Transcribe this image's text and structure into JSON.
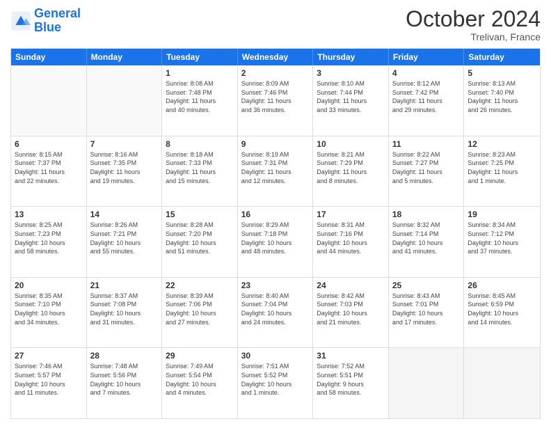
{
  "header": {
    "logo_line1": "General",
    "logo_line2": "Blue",
    "month": "October 2024",
    "location": "Trelivan, France"
  },
  "days_of_week": [
    "Sunday",
    "Monday",
    "Tuesday",
    "Wednesday",
    "Thursday",
    "Friday",
    "Saturday"
  ],
  "weeks": [
    [
      {
        "day": "",
        "lines": []
      },
      {
        "day": "",
        "lines": []
      },
      {
        "day": "1",
        "lines": [
          "Sunrise: 8:08 AM",
          "Sunset: 7:48 PM",
          "Daylight: 11 hours",
          "and 40 minutes."
        ]
      },
      {
        "day": "2",
        "lines": [
          "Sunrise: 8:09 AM",
          "Sunset: 7:46 PM",
          "Daylight: 11 hours",
          "and 36 minutes."
        ]
      },
      {
        "day": "3",
        "lines": [
          "Sunrise: 8:10 AM",
          "Sunset: 7:44 PM",
          "Daylight: 11 hours",
          "and 33 minutes."
        ]
      },
      {
        "day": "4",
        "lines": [
          "Sunrise: 8:12 AM",
          "Sunset: 7:42 PM",
          "Daylight: 11 hours",
          "and 29 minutes."
        ]
      },
      {
        "day": "5",
        "lines": [
          "Sunrise: 8:13 AM",
          "Sunset: 7:40 PM",
          "Daylight: 11 hours",
          "and 26 minutes."
        ]
      }
    ],
    [
      {
        "day": "6",
        "lines": [
          "Sunrise: 8:15 AM",
          "Sunset: 7:37 PM",
          "Daylight: 11 hours",
          "and 22 minutes."
        ]
      },
      {
        "day": "7",
        "lines": [
          "Sunrise: 8:16 AM",
          "Sunset: 7:35 PM",
          "Daylight: 11 hours",
          "and 19 minutes."
        ]
      },
      {
        "day": "8",
        "lines": [
          "Sunrise: 8:18 AM",
          "Sunset: 7:33 PM",
          "Daylight: 11 hours",
          "and 15 minutes."
        ]
      },
      {
        "day": "9",
        "lines": [
          "Sunrise: 8:19 AM",
          "Sunset: 7:31 PM",
          "Daylight: 11 hours",
          "and 12 minutes."
        ]
      },
      {
        "day": "10",
        "lines": [
          "Sunrise: 8:21 AM",
          "Sunset: 7:29 PM",
          "Daylight: 11 hours",
          "and 8 minutes."
        ]
      },
      {
        "day": "11",
        "lines": [
          "Sunrise: 8:22 AM",
          "Sunset: 7:27 PM",
          "Daylight: 11 hours",
          "and 5 minutes."
        ]
      },
      {
        "day": "12",
        "lines": [
          "Sunrise: 8:23 AM",
          "Sunset: 7:25 PM",
          "Daylight: 11 hours",
          "and 1 minute."
        ]
      }
    ],
    [
      {
        "day": "13",
        "lines": [
          "Sunrise: 8:25 AM",
          "Sunset: 7:23 PM",
          "Daylight: 10 hours",
          "and 58 minutes."
        ]
      },
      {
        "day": "14",
        "lines": [
          "Sunrise: 8:26 AM",
          "Sunset: 7:21 PM",
          "Daylight: 10 hours",
          "and 55 minutes."
        ]
      },
      {
        "day": "15",
        "lines": [
          "Sunrise: 8:28 AM",
          "Sunset: 7:20 PM",
          "Daylight: 10 hours",
          "and 51 minutes."
        ]
      },
      {
        "day": "16",
        "lines": [
          "Sunrise: 8:29 AM",
          "Sunset: 7:18 PM",
          "Daylight: 10 hours",
          "and 48 minutes."
        ]
      },
      {
        "day": "17",
        "lines": [
          "Sunrise: 8:31 AM",
          "Sunset: 7:16 PM",
          "Daylight: 10 hours",
          "and 44 minutes."
        ]
      },
      {
        "day": "18",
        "lines": [
          "Sunrise: 8:32 AM",
          "Sunset: 7:14 PM",
          "Daylight: 10 hours",
          "and 41 minutes."
        ]
      },
      {
        "day": "19",
        "lines": [
          "Sunrise: 8:34 AM",
          "Sunset: 7:12 PM",
          "Daylight: 10 hours",
          "and 37 minutes."
        ]
      }
    ],
    [
      {
        "day": "20",
        "lines": [
          "Sunrise: 8:35 AM",
          "Sunset: 7:10 PM",
          "Daylight: 10 hours",
          "and 34 minutes."
        ]
      },
      {
        "day": "21",
        "lines": [
          "Sunrise: 8:37 AM",
          "Sunset: 7:08 PM",
          "Daylight: 10 hours",
          "and 31 minutes."
        ]
      },
      {
        "day": "22",
        "lines": [
          "Sunrise: 8:39 AM",
          "Sunset: 7:06 PM",
          "Daylight: 10 hours",
          "and 27 minutes."
        ]
      },
      {
        "day": "23",
        "lines": [
          "Sunrise: 8:40 AM",
          "Sunset: 7:04 PM",
          "Daylight: 10 hours",
          "and 24 minutes."
        ]
      },
      {
        "day": "24",
        "lines": [
          "Sunrise: 8:42 AM",
          "Sunset: 7:03 PM",
          "Daylight: 10 hours",
          "and 21 minutes."
        ]
      },
      {
        "day": "25",
        "lines": [
          "Sunrise: 8:43 AM",
          "Sunset: 7:01 PM",
          "Daylight: 10 hours",
          "and 17 minutes."
        ]
      },
      {
        "day": "26",
        "lines": [
          "Sunrise: 8:45 AM",
          "Sunset: 6:59 PM",
          "Daylight: 10 hours",
          "and 14 minutes."
        ]
      }
    ],
    [
      {
        "day": "27",
        "lines": [
          "Sunrise: 7:46 AM",
          "Sunset: 5:57 PM",
          "Daylight: 10 hours",
          "and 11 minutes."
        ]
      },
      {
        "day": "28",
        "lines": [
          "Sunrise: 7:48 AM",
          "Sunset: 5:56 PM",
          "Daylight: 10 hours",
          "and 7 minutes."
        ]
      },
      {
        "day": "29",
        "lines": [
          "Sunrise: 7:49 AM",
          "Sunset: 5:54 PM",
          "Daylight: 10 hours",
          "and 4 minutes."
        ]
      },
      {
        "day": "30",
        "lines": [
          "Sunrise: 7:51 AM",
          "Sunset: 5:52 PM",
          "Daylight: 10 hours",
          "and 1 minute."
        ]
      },
      {
        "day": "31",
        "lines": [
          "Sunrise: 7:52 AM",
          "Sunset: 5:51 PM",
          "Daylight: 9 hours",
          "and 58 minutes."
        ]
      },
      {
        "day": "",
        "lines": []
      },
      {
        "day": "",
        "lines": []
      }
    ]
  ]
}
